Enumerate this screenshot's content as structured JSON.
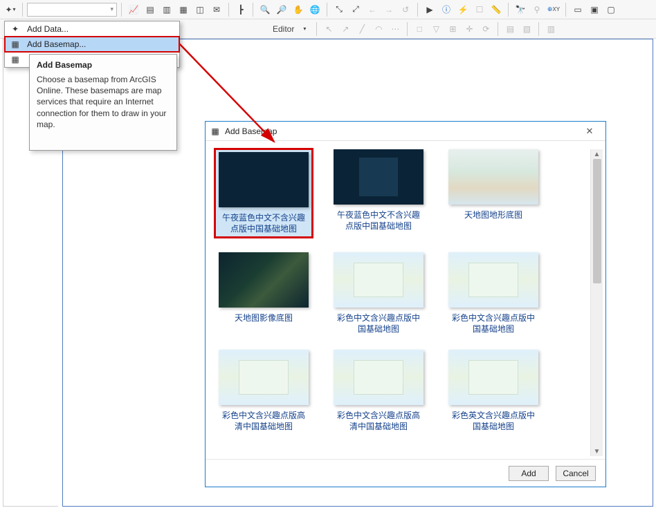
{
  "toolbar1": {
    "scale_placeholder": "",
    "icons": [
      "chart",
      "dashboard",
      "layers",
      "table",
      "cube",
      "mail",
      "org",
      "route"
    ]
  },
  "toolbar2": {
    "editor_label": "Editor"
  },
  "add_menu": {
    "items": [
      {
        "icon": "✦",
        "label": "Add Data..."
      },
      {
        "icon": "▦",
        "label": "Add Basemap..."
      },
      {
        "icon": "▦",
        "label": ""
      }
    ]
  },
  "tooltip": {
    "title": "Add Basemap",
    "body": "Choose a basemap from ArcGIS Online. These basemaps are map services that require an Internet connection for them to draw in your map."
  },
  "dialog": {
    "title": "Add Basemap",
    "add_label": "Add",
    "cancel_label": "Cancel",
    "cards": [
      {
        "variant": "dark",
        "label": "午夜蓝色中文不含兴趣点版中国基础地图",
        "selected": true
      },
      {
        "variant": "dark2",
        "label": "午夜蓝色中文不含兴趣点版中国基础地图"
      },
      {
        "variant": "terrain",
        "label": "天地图地形底图"
      },
      {
        "variant": "imagery",
        "label": "天地图影像底图"
      },
      {
        "variant": "color-map",
        "label": "彩色中文含兴趣点版中国基础地图"
      },
      {
        "variant": "color-map",
        "label": "彩色中文含兴趣点版中国基础地图"
      },
      {
        "variant": "color-map",
        "label": "彩色中文含兴趣点版高清中国基础地图"
      },
      {
        "variant": "color-map",
        "label": "彩色中文含兴趣点版高清中国基础地图"
      },
      {
        "variant": "color-map",
        "label": "彩色英文含兴趣点版中国基础地图"
      }
    ]
  }
}
